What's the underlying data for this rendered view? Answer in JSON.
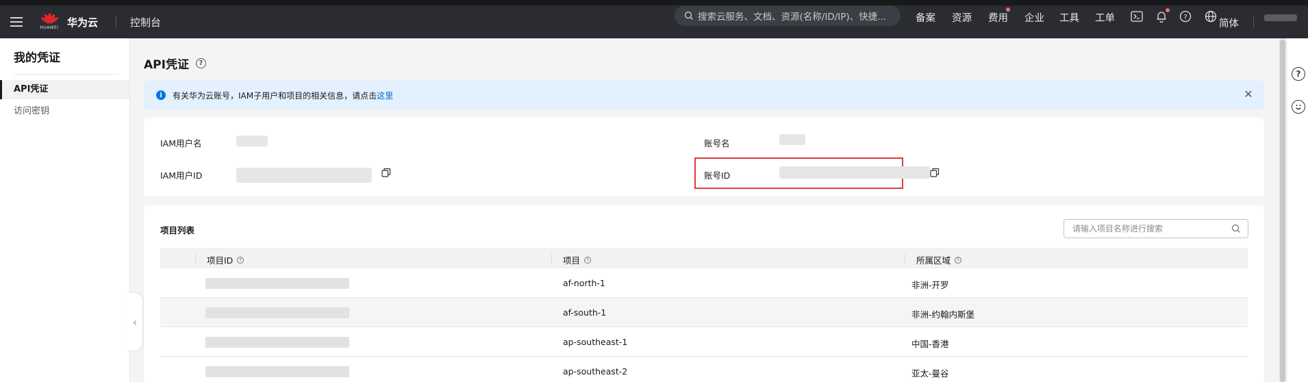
{
  "header": {
    "brand_word": "HUAWEI",
    "brand": "华为云",
    "console": "控制台",
    "search_placeholder": "搜索云服务、文档、资源(名称/ID/IP)、快捷...",
    "nav": [
      "备案",
      "资源",
      "费用",
      "企业",
      "工具",
      "工单"
    ],
    "language": "简体",
    "icons": [
      "menu-icon",
      "search-icon",
      "terminal-icon",
      "bell-icon",
      "help-icon",
      "globe-icon"
    ]
  },
  "sidebar": {
    "title": "我的凭证",
    "items": [
      {
        "label": "API凭证",
        "active": true
      },
      {
        "label": "访问密钥",
        "active": false
      }
    ]
  },
  "main": {
    "title": "API凭证",
    "notice": {
      "text": "有关华为云账号，IAM子用户和项目的相关信息，请点击",
      "link": "这里"
    },
    "credentials": {
      "iam_user_name_label": "IAM用户名",
      "account_name_label": "账号名",
      "iam_user_id_label": "IAM用户ID",
      "account_id_label": "账号ID"
    },
    "projects": {
      "title": "项目列表",
      "search_placeholder": "请输入项目名称进行搜索",
      "columns": [
        "项目ID",
        "项目",
        "所属区域"
      ],
      "rows": [
        {
          "project": "af-north-1",
          "region": "非洲-开罗"
        },
        {
          "project": "af-south-1",
          "region": "非洲-约翰内斯堡"
        },
        {
          "project": "ap-southeast-1",
          "region": "中国-香港"
        },
        {
          "project": "ap-southeast-2",
          "region": "亚太-曼谷"
        }
      ]
    }
  },
  "colors": {
    "topbar": "#2a2c32",
    "highlight": "#e03a3a",
    "notice_bg": "#e3f1ff",
    "link": "#0066cc",
    "huawei_red": "#e4262b"
  }
}
